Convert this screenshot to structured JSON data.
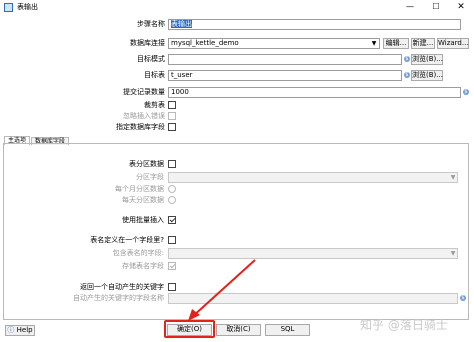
{
  "window": {
    "title": "表输出"
  },
  "form": {
    "step_name_label": "步骤名称",
    "step_name_value": "表输出",
    "db_conn_label": "数据库连接",
    "db_conn_value": "mysql_kettle_demo",
    "edit_btn": "编辑...",
    "new_btn": "新建...",
    "wizard_btn": "Wizard...",
    "target_schema_label": "目标模式",
    "target_schema_value": "",
    "browse_btn": "浏览(B)...",
    "target_table_label": "目标表",
    "target_table_value": "t_user",
    "commit_size_label": "提交记录数量",
    "commit_size_value": "1000",
    "truncate_label": "裁剪表",
    "ignore_errors_label": "忽略插入错误",
    "specify_fields_label": "指定数据库字段"
  },
  "tabs": [
    {
      "label": "主选项"
    },
    {
      "label": "数据库字段"
    }
  ],
  "main_tab": {
    "partition_label": "表分区数据",
    "partition_field_label": "分区字段",
    "partition_month_label": "每个月分区数据",
    "partition_day_label": "每天分区数据",
    "batch_insert_label": "使用批量插入",
    "name_in_field_label": "表名定义在一个字段里?",
    "name_field_label": "包含表名的字段:",
    "store_name_label": "存储表名字段",
    "return_key_label": "返回一个自动产生的关键字",
    "return_key_field_label": "自动产生的关键字的字段名称"
  },
  "bottom": {
    "help_btn": "Help",
    "ok_btn": "确定(O)",
    "cancel_btn": "取消(C)",
    "sql_btn": "SQL"
  },
  "watermark": "知乎 @落日骑士",
  "colors": {
    "selection": "#2b68c4",
    "highlight": "#e0231b"
  }
}
